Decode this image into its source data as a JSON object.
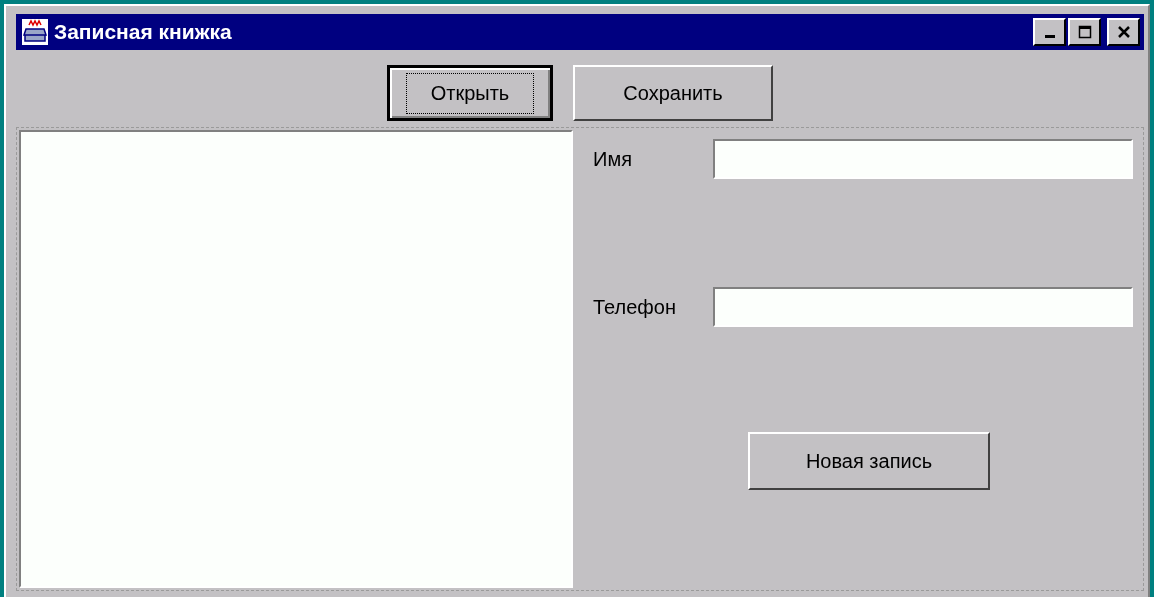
{
  "window": {
    "title": "Записная книжка"
  },
  "toolbar": [
    {
      "label": "Открыть",
      "focused": true
    },
    {
      "label": "Сохранить",
      "focused": false
    }
  ],
  "form": {
    "fields": [
      {
        "label": "Имя"
      },
      {
        "label": "Телефон"
      }
    ],
    "button": {
      "label": "Новая запись"
    }
  }
}
